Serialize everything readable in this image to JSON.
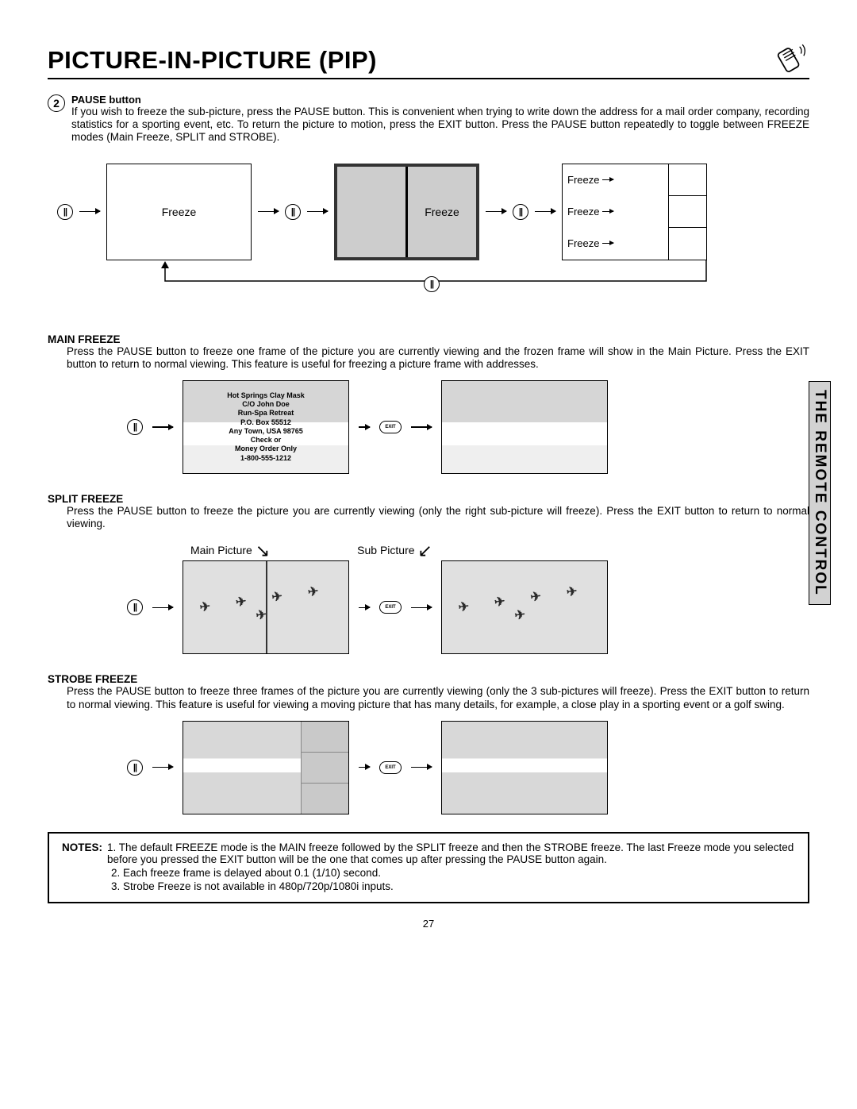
{
  "header": {
    "title": "PICTURE-IN-PICTURE (PIP)"
  },
  "side_tab": "THE REMOTE CONTROL",
  "section_pause": {
    "num": "2",
    "title": "PAUSE button",
    "body": "If you wish to freeze the sub-picture, press the PAUSE button. This is convenient when trying to write down the address for a mail order company, recording statistics for a sporting event, etc. To return the picture to motion, press the EXIT button. Press the PAUSE button repeatedly to toggle between FREEZE modes (Main Freeze, SPLIT and STROBE)."
  },
  "diagram": {
    "freeze": "Freeze",
    "strobe_lines": [
      "Freeze",
      "Freeze",
      "Freeze"
    ]
  },
  "main_freeze": {
    "title": "MAIN FREEZE",
    "body": "Press the PAUSE button to freeze one frame of the picture you are currently viewing and the frozen frame will show in the Main Picture.  Press the EXIT button to return to normal viewing.  This feature is useful for freezing a picture frame with addresses.",
    "address": [
      "Hot Springs Clay Mask",
      "C/O John Doe",
      "Run-Spa Retreat",
      "P.O. Box 55512",
      "Any Town, USA 98765",
      "Check or",
      "Money Order Only",
      "1-800-555-1212"
    ]
  },
  "split_freeze": {
    "title": "SPLIT FREEZE",
    "body": "Press the PAUSE button to freeze the picture you are currently viewing (only the right sub-picture will freeze). Press the EXIT button to return to normal viewing.",
    "main_label": "Main Picture",
    "sub_label": "Sub Picture"
  },
  "strobe_freeze": {
    "title": "STROBE FREEZE",
    "body": "Press the PAUSE button to freeze three frames of the picture you are currently viewing (only the 3 sub-pictures will freeze). Press the EXIT button to return to normal viewing. This feature is useful for viewing a moving picture that has many details, for example, a close play in a sporting event or a golf swing."
  },
  "notes": {
    "label": "NOTES:",
    "items": [
      "1. The default FREEZE mode is the MAIN freeze followed by the SPLIT freeze and then the STROBE freeze.  The last Freeze mode you selected before you pressed the EXIT button will be the one that comes up after pressing the PAUSE button again.",
      "2. Each freeze frame is delayed about 0.1 (1/10) second.",
      "3. Strobe Freeze is not available in 480p/720p/1080i inputs."
    ]
  },
  "buttons": {
    "exit": "EXIT"
  },
  "page": "27"
}
